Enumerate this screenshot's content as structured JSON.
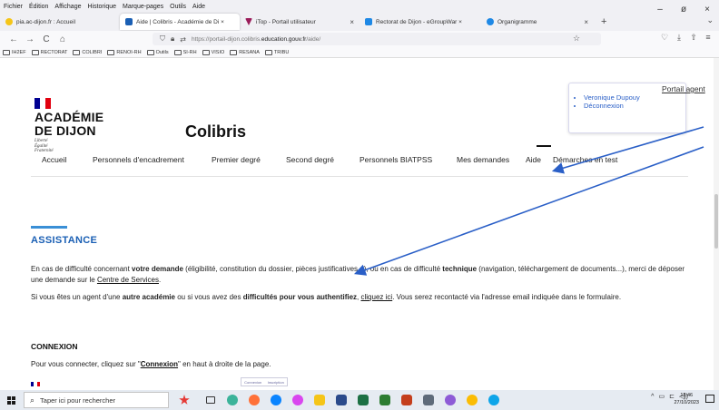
{
  "menubar": [
    "Fichier",
    "Édition",
    "Affichage",
    "Historique",
    "Marque-pages",
    "Outils",
    "Aide"
  ],
  "window_controls": {
    "minimize": "–",
    "maximize": "ø",
    "close": "×"
  },
  "tabs": [
    {
      "label": "pia.ac-dijon.fr : Accueil",
      "color": "#f5c518"
    },
    {
      "label": "Aide | Colibris - Académie de Di ×",
      "color": "#1a5fb4"
    },
    {
      "label": "iTop - Portail utilisateur",
      "color": "#9b1c5a"
    },
    {
      "label": "Rectorat de Dijon - eGroupWar ×",
      "color": "#1e88e5"
    },
    {
      "label": "Organigramme",
      "color": "#1e88e5"
    }
  ],
  "tab_new": "+",
  "tab_list": "⌄",
  "nav": {
    "back": "←",
    "forward": "→",
    "reload": "C",
    "home": "⌂",
    "url_prefix": "https://portail-dijon.colibris.",
    "url_domain": "education.gouv.fr",
    "url_suffix": "/aide/",
    "bookmark_star": "☆"
  },
  "nav_right": [
    "♡",
    "⤓",
    "⇧",
    "≡"
  ],
  "bookmarks": [
    "IH2EF",
    "RECTORAT",
    "COLIBRI",
    "RENOI-RH",
    "Outils",
    "SI-RH",
    "VISIO",
    "RESANA",
    "TRIBU"
  ],
  "header": {
    "academie_line1": "ACADÉMIE",
    "academie_line2": "DE DIJON",
    "devise": [
      "Liberté",
      "Égalité",
      "Fraternité"
    ],
    "site_title": "Colibris",
    "portal_link": "Portail agent",
    "user_links": [
      "Veronique Dupouy",
      "Déconnexion"
    ]
  },
  "mainnav": [
    "Accueil",
    "Personnels d'encadrement",
    "Premier degré",
    "Second degré",
    "Personnels BIATPSS",
    "Mes demandes",
    "Aide",
    "Démarches en test"
  ],
  "content": {
    "assist_title": "ASSISTANCE",
    "p1_a": "En cas de difficulté concernant ",
    "p1_b": "votre demande",
    "p1_c": " (éligibilité, constitution du dossier, pièces justificatives...), ou en cas de difficulté ",
    "p1_d": "technique",
    "p1_e": " (navigation, téléchargement de documents...), merci de déposer une demande sur le ",
    "p1_link": "Centre de Services",
    "p1_end": ".",
    "p2_a": "Si vous êtes un agent d'une ",
    "p2_b": "autre académie",
    "p2_c": " ou si vous avez des ",
    "p2_d": "difficultés pour vous authentifiez",
    "p2_e": ", ",
    "p2_link": "cliquez ici",
    "p2_f": ". Vous serez recontacté via l'adresse email indiquée dans le formulaire.",
    "conn_title": "CONNEXION",
    "p3_a": "Pour vous connecter, cliquez sur \"",
    "p3_b": "Connexion",
    "p3_c": "\" en haut à droite de la page.",
    "mini_popup": [
      "Connexion",
      "Inscription"
    ]
  },
  "taskbar": {
    "search_placeholder": "Taper ici pour rechercher",
    "tray": [
      "^",
      "▭",
      "⊏",
      "◁))"
    ],
    "time": "13:46",
    "date": "27/10/2023"
  },
  "colors": {
    "link_blue": "#1a5fb4",
    "accent": "#3a8fd6",
    "arrow": "#2a5fc7"
  }
}
